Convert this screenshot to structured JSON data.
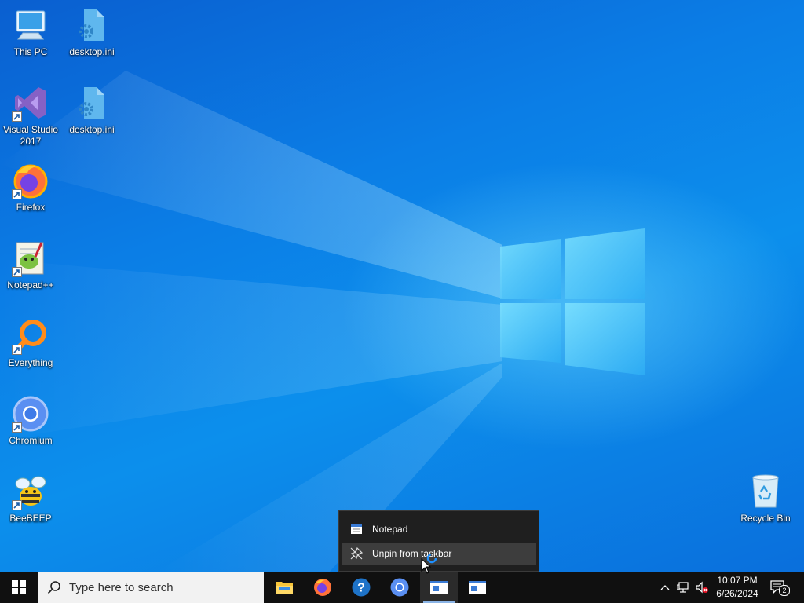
{
  "desktop": {
    "icons": [
      {
        "label": "This PC",
        "icon": "this-pc-icon"
      },
      {
        "label": "desktop.ini",
        "icon": "settings-file-icon"
      },
      {
        "label": "Visual Studio 2017",
        "icon": "visual-studio-icon"
      },
      {
        "label": "desktop.ini",
        "icon": "settings-file-icon"
      },
      {
        "label": "Firefox",
        "icon": "firefox-icon"
      },
      {
        "label": "Notepad++",
        "icon": "notepad-plus-plus-icon"
      },
      {
        "label": "Everything",
        "icon": "everything-search-icon"
      },
      {
        "label": "Chromium",
        "icon": "chromium-icon"
      },
      {
        "label": "BeeBEEP",
        "icon": "beebeep-icon"
      },
      {
        "label": "Recycle Bin",
        "icon": "recycle-bin-icon"
      }
    ]
  },
  "jumplist": {
    "app_label": "Notepad",
    "unpin_label": "Unpin from taskbar"
  },
  "taskbar": {
    "search_placeholder": "Type here to search",
    "apps": [
      "file-explorer-icon",
      "firefox-icon",
      "help-icon",
      "chromium-icon",
      "notepad-icon",
      "notepad-icon"
    ]
  },
  "tray": {
    "time": "10:07 PM",
    "date": "6/26/2024",
    "notification_count": "2"
  },
  "colors": {
    "taskbar": "#101010",
    "desktop_blue": "#0b7ee6",
    "jumplist_bg": "#1f1f1f",
    "jumplist_hover": "#3d3d3d"
  }
}
